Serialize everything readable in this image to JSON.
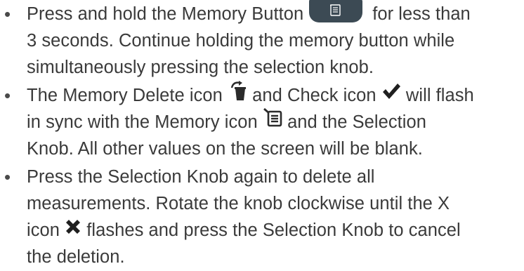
{
  "bullet_char": "•",
  "colors": {
    "text": "#3a3a3a",
    "button": "#3c4a54",
    "icon": "#2b2b2b"
  },
  "items": [
    {
      "lines": [
        {
          "pre": "Press and hold the Memory Button",
          "post": "for less than",
          "icon": "memory-button"
        },
        {
          "text": "3 seconds. Continue holding the memory button while"
        },
        {
          "text": "simultaneously pressing the selection knob."
        }
      ]
    },
    {
      "lines": [
        {
          "a": "The Memory Delete icon",
          "b": "and Check icon",
          "c": "will flash",
          "icons": [
            "memory-delete-icon",
            "check-icon"
          ]
        },
        {
          "a": "in sync with the Memory icon",
          "b": "and the Selection",
          "icons": [
            "memory-icon"
          ]
        },
        {
          "text": "Knob. All other values on the screen will be blank."
        }
      ]
    },
    {
      "lines": [
        {
          "text": "Press the Selection Knob again to delete all"
        },
        {
          "text": "measurements. Rotate the knob clockwise until the X"
        },
        {
          "a": "icon",
          "b": "flashes and press the Selection Knob to cancel",
          "icons": [
            "x-icon"
          ]
        },
        {
          "text": "the deletion."
        }
      ]
    }
  ]
}
